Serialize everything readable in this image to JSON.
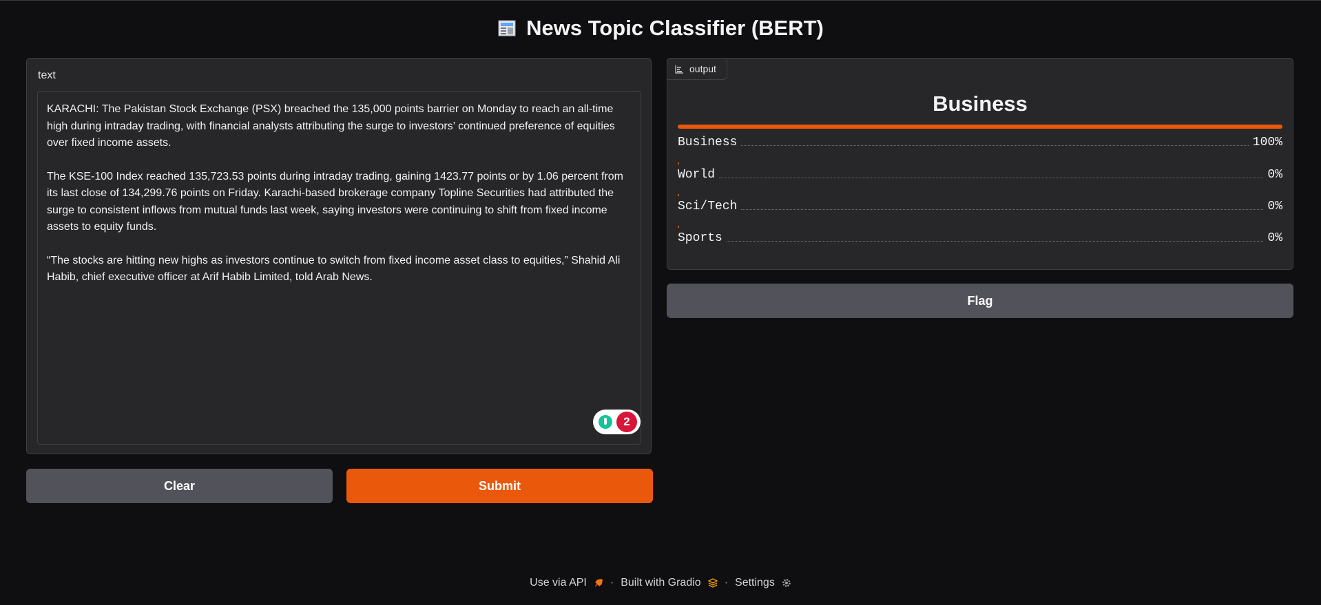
{
  "app": {
    "title": "News Topic Classifier (BERT)",
    "title_icon": "newspaper-icon"
  },
  "input": {
    "label": "text",
    "paragraphs": [
      "KARACHI: The Pakistan Stock Exchange (PSX) breached the 135,000 points barrier on Monday to reach an all-time high during intraday trading, with financial analysts attributing the surge to investors’ continued preference of equities over fixed income assets.",
      "The KSE-100 Index reached 135,723.53 points during intraday trading, gaining 1423.77 points or by 1.06 percent from its last close of 134,299.76 points on Friday. Karachi-based brokerage company Topline Securities had attributed the surge to consistent inflows from mutual funds last week, saying investors were continuing to shift from fixed income assets to equity funds.",
      "“The stocks are hitting new highs as investors continue to switch from fixed income asset class to equities,” Shahid Ali Habib, chief executive officer at Arif Habib Limited, told Arab News."
    ],
    "grammar_badge_count": "2"
  },
  "buttons": {
    "clear": "Clear",
    "submit": "Submit",
    "flag": "Flag"
  },
  "output": {
    "tag_label": "output",
    "tag_icon": "bar-chart-icon",
    "top_label": "Business",
    "confidences": [
      {
        "label": "Business",
        "value_text": "100%",
        "value": 1.0
      },
      {
        "label": "World",
        "value_text": "0%",
        "value": 0.0
      },
      {
        "label": "Sci/Tech",
        "value_text": "0%",
        "value": 0.0
      },
      {
        "label": "Sports",
        "value_text": "0%",
        "value": 0.0
      }
    ],
    "bar_color": "#ea580c"
  },
  "footer": {
    "api": "Use via API",
    "sep": "·",
    "built": "Built with Gradio",
    "settings": "Settings"
  }
}
